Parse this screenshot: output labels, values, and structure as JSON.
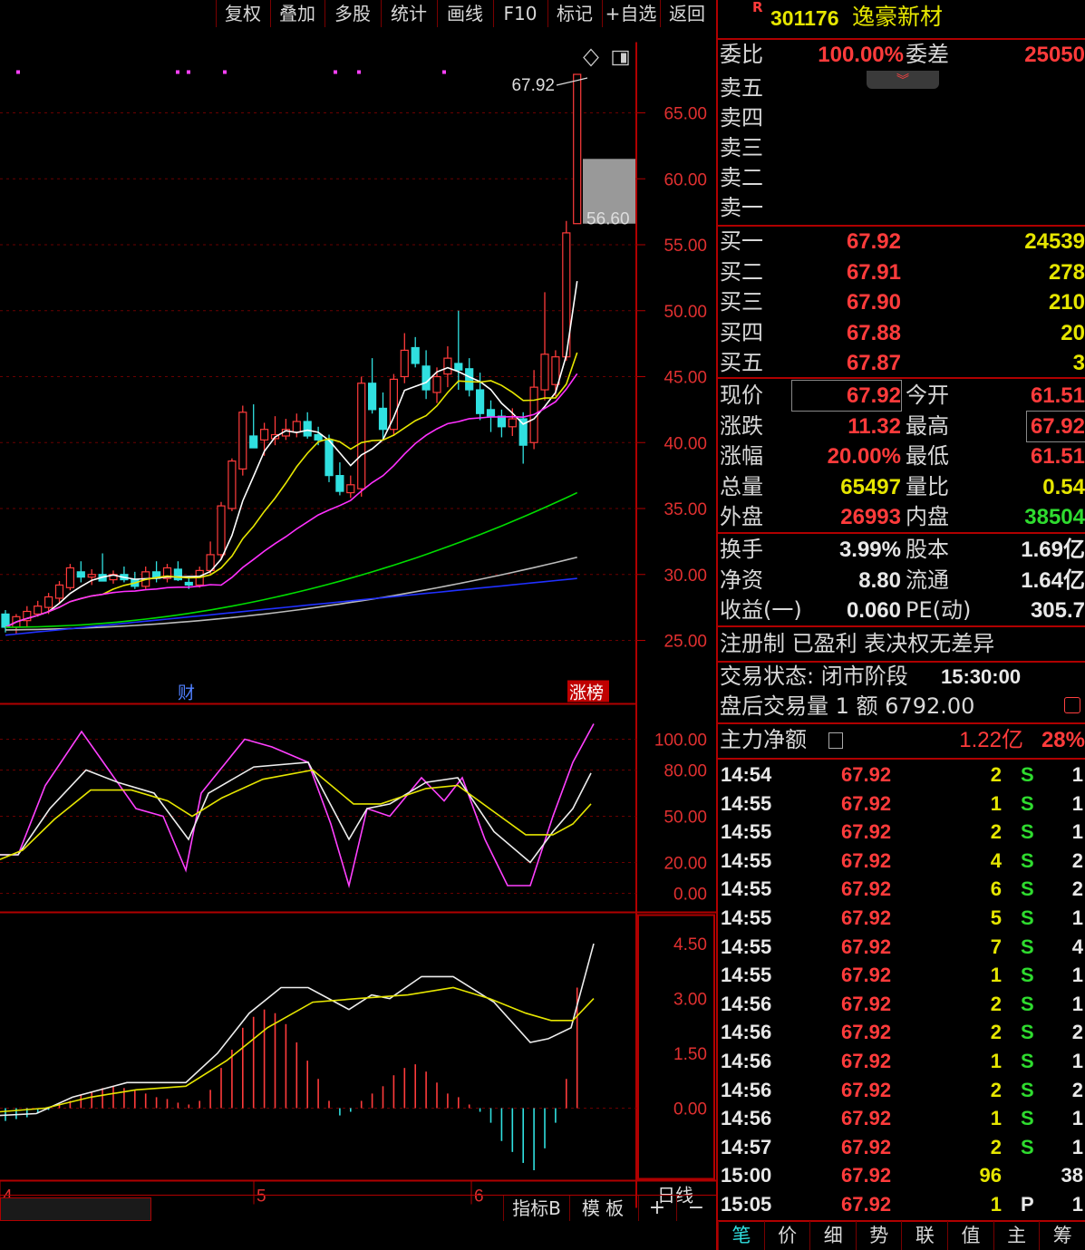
{
  "toolbar": {
    "buttons": [
      "复权",
      "叠加",
      "多股",
      "统计",
      "画线",
      "F10",
      "标记",
      "+自选",
      "返回"
    ]
  },
  "chart": {
    "price_axis": [
      "65.00",
      "60.00",
      "55.00",
      "50.00",
      "45.00",
      "40.00",
      "35.00",
      "30.00",
      "25.00"
    ],
    "high_marker": "67.92",
    "low_marker": "56.60",
    "badge_finance": "财",
    "badge_limitup": "涨榜",
    "kdj_axis": [
      "100.00",
      "80.00",
      "50.00",
      "20.00",
      "0.00"
    ],
    "macd_axis": [
      "4.50",
      "3.00",
      "1.50",
      "0.00"
    ],
    "date_labels": [
      "4",
      "5",
      "6"
    ],
    "period_label": "日线"
  },
  "statusbar": {
    "indicator_label": "指标B",
    "template_label": "模 板",
    "plus": "+",
    "minus": "−"
  },
  "quote": {
    "r_badge": "R",
    "code": "301176",
    "name": "逸豪新材",
    "weibi_label": "委比",
    "weibi_value": "100.00%",
    "weicha_label": "委差",
    "weicha_value": "25050",
    "sell": [
      {
        "label": "卖五"
      },
      {
        "label": "卖四"
      },
      {
        "label": "卖三"
      },
      {
        "label": "卖二"
      },
      {
        "label": "卖一"
      }
    ],
    "buy": [
      {
        "label": "买一",
        "price": "67.92",
        "vol": "24539"
      },
      {
        "label": "买二",
        "price": "67.91",
        "vol": "278"
      },
      {
        "label": "买三",
        "price": "67.90",
        "vol": "210"
      },
      {
        "label": "买四",
        "price": "67.88",
        "vol": "20"
      },
      {
        "label": "买五",
        "price": "67.87",
        "vol": "3"
      }
    ],
    "stats": [
      {
        "l1": "现价",
        "v1": "67.92",
        "l2": "今开",
        "v2": "61.51"
      },
      {
        "l1": "涨跌",
        "v1": "11.32",
        "l2": "最高",
        "v2": "67.92"
      },
      {
        "l1": "涨幅",
        "v1": "20.00%",
        "l2": "最低",
        "v2": "61.51"
      },
      {
        "l1": "总量",
        "v1": "65497",
        "l2": "量比",
        "v2": "0.54"
      },
      {
        "l1": "外盘",
        "v1": "26993",
        "l2": "内盘",
        "v2": "38504"
      }
    ],
    "fund": [
      {
        "l1": "换手",
        "v1": "3.99%",
        "l2": "股本",
        "v2": "1.69亿"
      },
      {
        "l1": "净资",
        "v1": "8.80",
        "l2": "流通",
        "v2": "1.64亿"
      },
      {
        "l1": "收益(一)",
        "v1": "0.060",
        "l2": "PE(动)",
        "v2": "305.7"
      }
    ],
    "tags": "注册制 已盈利 表决权无差异",
    "trade_status_label": "交易状态: 闭市阶段",
    "trade_status_time": "15:30:00",
    "after_hours": "盘后交易量 1 额 6792.00",
    "main_net_label": "主力净额",
    "main_net_value": "1.22亿",
    "main_net_pct": "28%"
  },
  "ticks": [
    {
      "t": "14:54",
      "p": "67.92",
      "v": "2",
      "s": "S",
      "n": "1"
    },
    {
      "t": "14:55",
      "p": "67.92",
      "v": "1",
      "s": "S",
      "n": "1"
    },
    {
      "t": "14:55",
      "p": "67.92",
      "v": "2",
      "s": "S",
      "n": "1"
    },
    {
      "t": "14:55",
      "p": "67.92",
      "v": "4",
      "s": "S",
      "n": "2"
    },
    {
      "t": "14:55",
      "p": "67.92",
      "v": "6",
      "s": "S",
      "n": "2"
    },
    {
      "t": "14:55",
      "p": "67.92",
      "v": "5",
      "s": "S",
      "n": "1"
    },
    {
      "t": "14:55",
      "p": "67.92",
      "v": "7",
      "s": "S",
      "n": "4"
    },
    {
      "t": "14:55",
      "p": "67.92",
      "v": "1",
      "s": "S",
      "n": "1"
    },
    {
      "t": "14:56",
      "p": "67.92",
      "v": "2",
      "s": "S",
      "n": "1"
    },
    {
      "t": "14:56",
      "p": "67.92",
      "v": "2",
      "s": "S",
      "n": "2"
    },
    {
      "t": "14:56",
      "p": "67.92",
      "v": "1",
      "s": "S",
      "n": "1"
    },
    {
      "t": "14:56",
      "p": "67.92",
      "v": "2",
      "s": "S",
      "n": "2"
    },
    {
      "t": "14:56",
      "p": "67.92",
      "v": "1",
      "s": "S",
      "n": "1"
    },
    {
      "t": "14:57",
      "p": "67.92",
      "v": "2",
      "s": "S",
      "n": "1"
    },
    {
      "t": "15:00",
      "p": "67.92",
      "v": "96",
      "s": "",
      "n": "38"
    },
    {
      "t": "15:05",
      "p": "67.92",
      "v": "1",
      "s": "P",
      "n": "1"
    }
  ],
  "bottom_tabs": [
    "笔",
    "价",
    "细",
    "势",
    "联",
    "值",
    "主",
    "筹"
  ],
  "colors": {
    "up": "#ff3b3b",
    "down": "#30e0e0",
    "ma5": "#ffffff",
    "ma10": "#e6e600",
    "ma20": "#ff30ff",
    "ma60": "#00dd00",
    "ma120": "#bbbbbb",
    "ma250": "#2030ff",
    "border": "#b00000"
  }
}
